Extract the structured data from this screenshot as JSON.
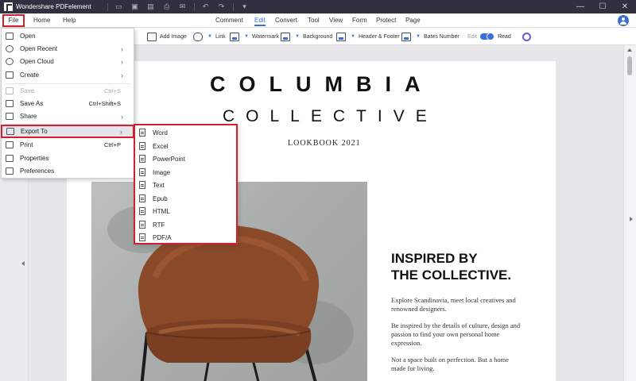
{
  "app": {
    "title": "Wondershare PDFelement"
  },
  "quick_access": [
    "folder-icon",
    "save-icon",
    "save-as-icon",
    "print-icon",
    "email-icon",
    "undo-icon",
    "redo-icon",
    "customize-icon"
  ],
  "window_controls": {
    "minimize": "—",
    "maximize": "☐",
    "close": "✕"
  },
  "menubar": {
    "file": "File",
    "home": "Home",
    "help": "Help",
    "tabs": [
      "Comment",
      "Edit",
      "Convert",
      "Tool",
      "View",
      "Form",
      "Protect",
      "Page"
    ],
    "active_tab": "Edit"
  },
  "toolbar": {
    "add_image": "Add Image",
    "link": "Link",
    "watermark": "Watermark",
    "background": "Background",
    "header_footer": "Header & Footer",
    "bates_number": "Bates Number",
    "edit": "Edit",
    "read": "Read"
  },
  "file_menu": {
    "items": [
      {
        "label": "Open",
        "shortcut": "",
        "arrow": "",
        "icon": "open-icon"
      },
      {
        "label": "Open Recent",
        "shortcut": "",
        "arrow": "›",
        "icon": "clock-icon"
      },
      {
        "label": "Open Cloud",
        "shortcut": "",
        "arrow": "›",
        "icon": "cloud-icon"
      },
      {
        "label": "Create",
        "shortcut": "",
        "arrow": "›",
        "icon": "plus-icon"
      },
      {
        "label": "Save",
        "shortcut": "Ctrl+S",
        "arrow": "",
        "icon": "save-icon"
      },
      {
        "label": "Save As",
        "shortcut": "Ctrl+Shift+S",
        "arrow": "",
        "icon": "save-as-icon"
      },
      {
        "label": "Share",
        "shortcut": "",
        "arrow": "›",
        "icon": "share-icon"
      },
      {
        "label": "Export To",
        "shortcut": "",
        "arrow": "›",
        "icon": "export-icon"
      },
      {
        "label": "Print",
        "shortcut": "Ctrl+P",
        "arrow": "",
        "icon": "print-icon"
      },
      {
        "label": "Properties",
        "shortcut": "",
        "arrow": "",
        "icon": "list-icon"
      },
      {
        "label": "Preferences",
        "shortcut": "",
        "arrow": "",
        "icon": "preferences-icon"
      }
    ]
  },
  "export_submenu": [
    "Word",
    "Excel",
    "PowerPoint",
    "Image",
    "Text",
    "Epub",
    "HTML",
    "RTF",
    "PDF/A"
  ],
  "document": {
    "title": "COLUMBIA",
    "subtitle": "COLLECTIVE",
    "lookbook": "LOOKBOOK 2021",
    "heading": "INSPIRED BY\nTHE COLLECTIVE.",
    "paragraphs": [
      "Explore Scandinavia, meet local creatives and renowned designers.",
      "Be inspired by the details of culture, design and passion to find your own personal home expression.",
      "Not a space built on perfection. But a home made for living."
    ]
  },
  "colors": {
    "accent": "#3a6fd8",
    "highlight": "#d3202f",
    "titlebar": "#2f3140",
    "chair": "#8a4a2a"
  }
}
